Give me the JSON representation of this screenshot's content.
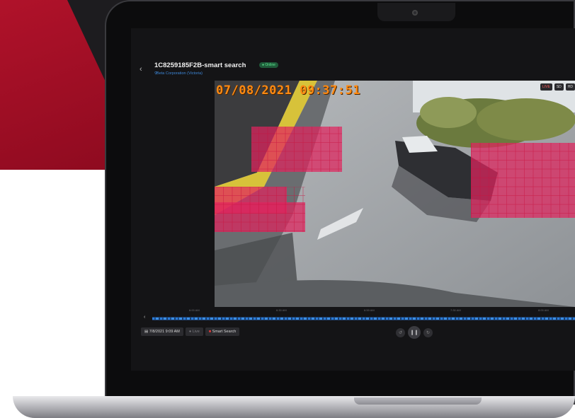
{
  "app": {
    "camera_title": "1C8259185F2B-smart search",
    "status_badge": "Online",
    "location": "Beta Corporation (Victoria)",
    "back_icon": "chevron-left-icon",
    "pin_icon": "map-pin-icon"
  },
  "video": {
    "overlay_timestamp": "07/08/2021 09:37:51",
    "stream_controls": [
      "LIVE",
      "SD",
      "HD"
    ],
    "motion_color": "#e0245e"
  },
  "timeline": {
    "ticks": [
      "6:00 AM",
      "6:30 AM",
      "6:59 AM",
      "7:30 AM",
      "8:00 AM"
    ],
    "accent": "#2b7bd8"
  },
  "toolbar": {
    "date_button": "7/8/2021 9:09 AM",
    "live_button": "Live",
    "smart_search_button": "Smart Search"
  },
  "brand": {
    "red": "#b0122a"
  }
}
